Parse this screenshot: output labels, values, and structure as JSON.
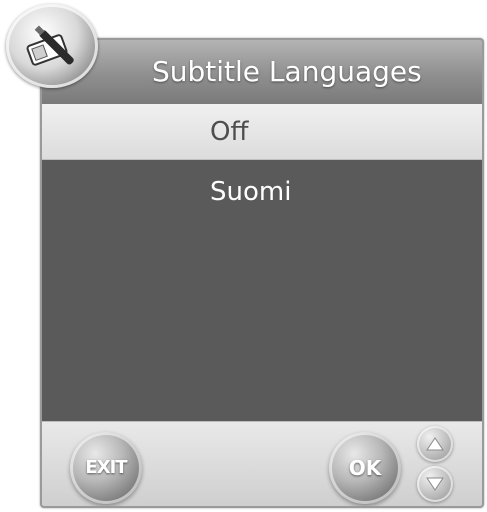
{
  "dialog": {
    "title": "Subtitle Languages",
    "items": [
      {
        "label": "Off",
        "selected": true
      },
      {
        "label": "Suomi",
        "selected": false
      }
    ],
    "footer": {
      "exit_label": "EXIT",
      "ok_label": "OK",
      "up_icon": "arrow-up-icon",
      "down_icon": "arrow-down-icon"
    },
    "header_icon": "settings-tools-icon"
  },
  "colors": {
    "list_background": "#5a5a5a",
    "selected_row": "#e6e6e6",
    "header": "#9a9a9a"
  }
}
